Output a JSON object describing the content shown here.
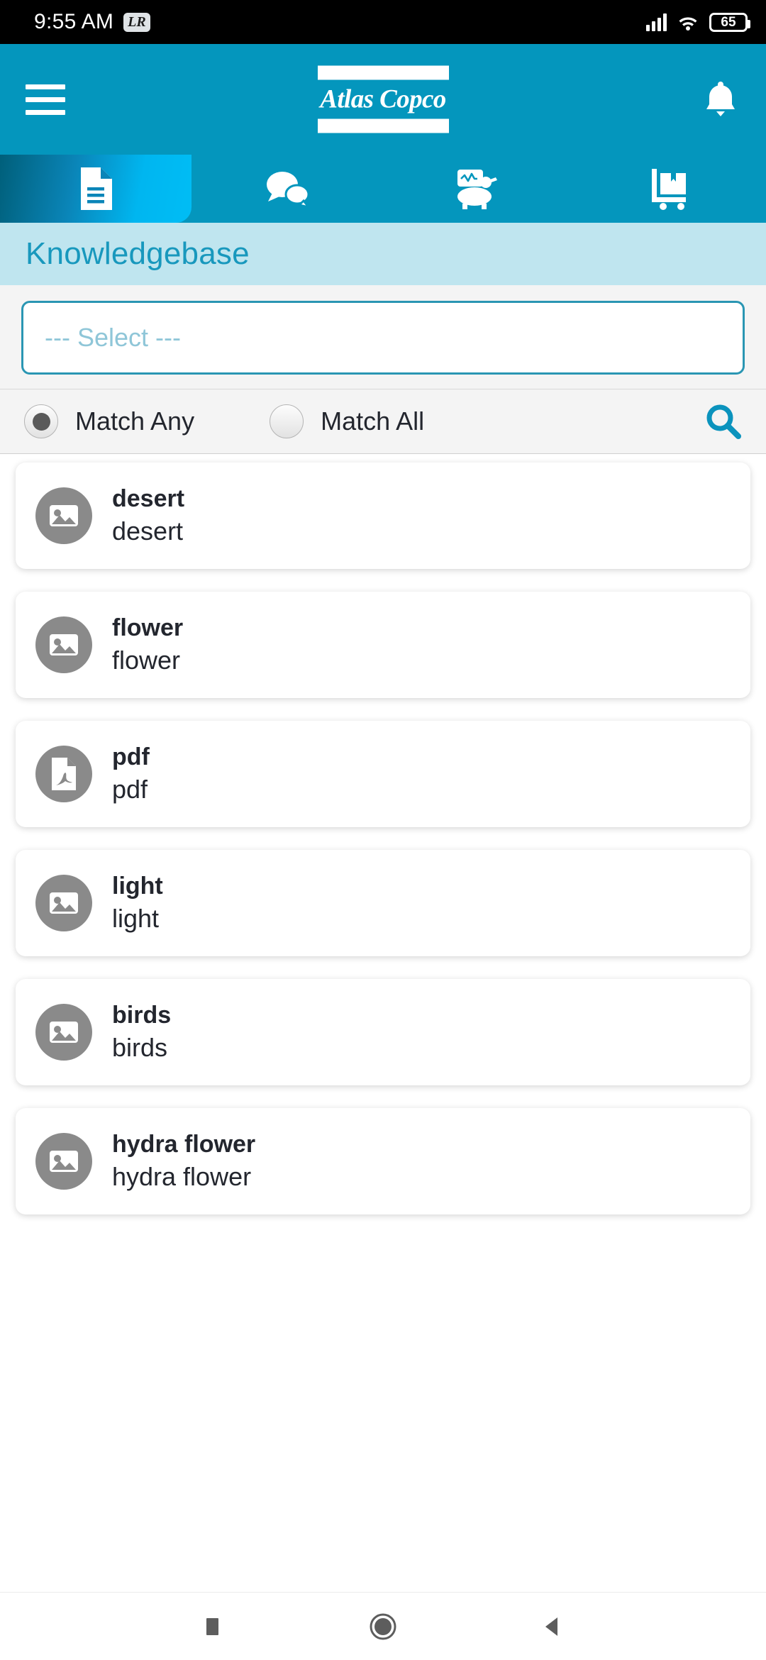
{
  "status_bar": {
    "time": "9:55 AM",
    "app_badge": "LR",
    "battery_percent": "65"
  },
  "header": {
    "menu_icon": "hamburger-menu-icon",
    "brand": "Atlas Copco",
    "notification_icon": "bell-icon"
  },
  "tabs": [
    {
      "name": "documents",
      "icon": "document-icon",
      "active": true
    },
    {
      "name": "chat",
      "icon": "chat-bubbles-icon",
      "active": false
    },
    {
      "name": "equipment",
      "icon": "air-compressor-icon",
      "active": false
    },
    {
      "name": "orders",
      "icon": "hand-truck-box-icon",
      "active": false
    }
  ],
  "page": {
    "title": "Knowledgebase"
  },
  "filters": {
    "select_placeholder": "--- Select ---",
    "match_any_label": "Match Any",
    "match_all_label": "Match All",
    "selected_match": "Match Any",
    "search_icon": "search-icon"
  },
  "results": [
    {
      "icon": "image-icon",
      "title": "desert",
      "subtitle": "desert"
    },
    {
      "icon": "image-icon",
      "title": "flower",
      "subtitle": "flower"
    },
    {
      "icon": "pdf-file-icon",
      "title": "pdf",
      "subtitle": "pdf"
    },
    {
      "icon": "image-icon",
      "title": "light",
      "subtitle": "light"
    },
    {
      "icon": "image-icon",
      "title": "birds",
      "subtitle": "birds"
    },
    {
      "icon": "image-icon",
      "title": "hydra flower",
      "subtitle": "hydra flower"
    }
  ],
  "system_nav": {
    "recents_icon": "square-recents-icon",
    "home_icon": "circle-home-icon",
    "back_icon": "triangle-back-icon"
  },
  "colors": {
    "brand_blue": "#0496bd",
    "title_band": "#bfe5ef",
    "title_text": "#1898bd",
    "accent_cyan": "#00bdf5",
    "avatar_gray": "#8a8a8a",
    "text_dark": "#23262e"
  }
}
